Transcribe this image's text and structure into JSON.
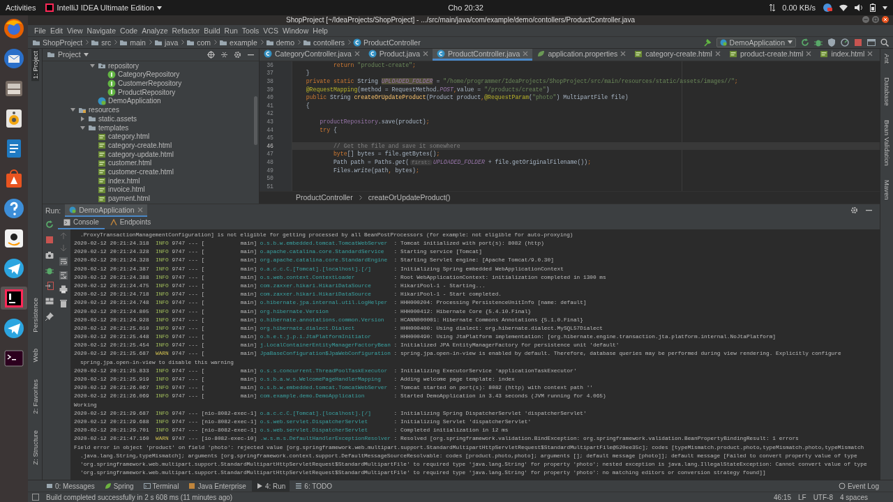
{
  "top_bar": {
    "activities": "Activities",
    "app_menu": "IntelliJ IDEA Ultimate Edition",
    "clock": "Cho 20:32",
    "net_speed": "0.00 KB/s"
  },
  "window": {
    "title": "ShopProject [~/IdeaProjects/ShopProject] - .../src/main/java/com/example/demo/contollers/ProductController.java"
  },
  "menu": [
    "File",
    "Edit",
    "View",
    "Navigate",
    "Code",
    "Analyze",
    "Refactor",
    "Build",
    "Run",
    "Tools",
    "VCS",
    "Window",
    "Help"
  ],
  "nav_bar": {
    "crumbs": [
      {
        "label": "ShopProject",
        "kind": "project"
      },
      {
        "label": "src",
        "kind": "folder"
      },
      {
        "label": "main",
        "kind": "folder"
      },
      {
        "label": "java",
        "kind": "folder"
      },
      {
        "label": "com",
        "kind": "folder"
      },
      {
        "label": "example",
        "kind": "folder"
      },
      {
        "label": "demo",
        "kind": "folder"
      },
      {
        "label": "contollers",
        "kind": "folder"
      },
      {
        "label": "ProductController",
        "kind": "class"
      }
    ],
    "run_config": "DemoApplication"
  },
  "left_strip": {
    "top": [
      {
        "label": "1: Project",
        "selected": true
      }
    ],
    "bottom": [
      {
        "label": "Persistence",
        "selected": false
      },
      {
        "label": "Web",
        "selected": false
      },
      {
        "label": "2: Favorites",
        "selected": false
      },
      {
        "label": "Z: Structure",
        "selected": false
      }
    ]
  },
  "right_strip": [
    {
      "label": "Ant"
    },
    {
      "label": "Database"
    },
    {
      "label": "Bean Validation"
    },
    {
      "label": "Maven"
    }
  ],
  "project": {
    "title": "Project",
    "tree": [
      {
        "children": [
          {
            "children": [
              {
                "name": "repository",
                "kind": "package",
                "expanded": true,
                "children": [
                  {
                    "name": "CategoryRepository",
                    "kind": "interface"
                  },
                  {
                    "name": "CustomerRepository",
                    "kind": "interface"
                  },
                  {
                    "name": "ProductRepository",
                    "kind": "interface"
                  }
                ]
              },
              {
                "name": "DemoApplication",
                "kind": "spring-class"
              }
            ]
          }
        ]
      },
      {
        "name": "resources",
        "kind": "resources",
        "expanded": true,
        "children": [
          {
            "name": "static.assets",
            "kind": "folder",
            "expanded": false
          },
          {
            "name": "templates",
            "kind": "folder",
            "expanded": true,
            "children": [
              {
                "name": "category.html",
                "kind": "html"
              },
              {
                "name": "category-create.html",
                "kind": "html"
              },
              {
                "name": "category-update.html",
                "kind": "html"
              },
              {
                "name": "customer.html",
                "kind": "html"
              },
              {
                "name": "customer-create.html",
                "kind": "html"
              },
              {
                "name": "index.html",
                "kind": "html"
              },
              {
                "name": "invoice.html",
                "kind": "html"
              },
              {
                "name": "payment.html",
                "kind": "html"
              }
            ]
          }
        ]
      }
    ]
  },
  "editor": {
    "tabs": [
      {
        "label": "CategoryController.java",
        "kind": "class",
        "selected": false
      },
      {
        "label": "Product.java",
        "kind": "class",
        "selected": false
      },
      {
        "label": "ProductController.java",
        "kind": "class",
        "selected": true
      },
      {
        "label": "application.properties",
        "kind": "properties",
        "selected": false
      },
      {
        "label": "category-create.html",
        "kind": "html",
        "selected": false
      },
      {
        "label": "product-create.html",
        "kind": "html",
        "selected": false
      },
      {
        "label": "index.html",
        "kind": "html",
        "selected": false
      }
    ],
    "lines": [
      {
        "number": "36",
        "current": false,
        "segments": [
          {
            "kind": "kw",
            "text": "            return "
          },
          {
            "kind": "str",
            "text": "\"product-create\""
          },
          {
            "kind": "kw",
            "text": ";"
          }
        ]
      },
      {
        "number": "37",
        "current": false,
        "segments": [
          {
            "kind": "plain",
            "text": "    }"
          }
        ]
      },
      {
        "number": "38",
        "current": false,
        "segments": [
          {
            "kind": "kw",
            "text": "    private static "
          },
          {
            "kind": "plain",
            "text": "String "
          },
          {
            "kind": "const-hl",
            "text": "UPLOADED_FOLDER"
          },
          {
            "kind": "plain",
            "text": " = "
          },
          {
            "kind": "str",
            "text": "\"/home/programmer/IdeaProjects/ShopProject/src/main/resources/static/assets/images//\""
          },
          {
            "kind": "kw",
            "text": ";"
          }
        ]
      },
      {
        "number": "39",
        "current": false,
        "segments": [
          {
            "kind": "ann",
            "text": "    @RequestMapping"
          },
          {
            "kind": "plain",
            "text": "(method = RequestMethod."
          },
          {
            "kind": "const",
            "text": "POST"
          },
          {
            "kind": "kw",
            "text": ","
          },
          {
            "kind": "plain",
            "text": "value = "
          },
          {
            "kind": "str",
            "text": "\"/products/create\""
          },
          {
            "kind": "plain",
            "text": ")"
          }
        ]
      },
      {
        "number": "40",
        "current": false,
        "segments": [
          {
            "kind": "kw",
            "text": "    public "
          },
          {
            "kind": "plain",
            "text": "String "
          },
          {
            "kind": "method",
            "text": "createOrUpdateProduct"
          },
          {
            "kind": "plain",
            "text": "(Product product"
          },
          {
            "kind": "kw",
            "text": ","
          },
          {
            "kind": "ann",
            "text": "@RequestParam"
          },
          {
            "kind": "plain",
            "text": "("
          },
          {
            "kind": "str",
            "text": "\"photo\""
          },
          {
            "kind": "plain",
            "text": ") MultipartFile file)"
          }
        ]
      },
      {
        "number": "41",
        "current": false,
        "segments": [
          {
            "kind": "plain",
            "text": "    {"
          }
        ]
      },
      {
        "number": "42",
        "current": false
      },
      {
        "number": "43",
        "current": false,
        "segments": [
          {
            "kind": "field",
            "text": "        productRepository"
          },
          {
            "kind": "plain",
            "text": ".save(product)"
          },
          {
            "kind": "kw",
            "text": ";"
          }
        ]
      },
      {
        "number": "44",
        "current": false,
        "segments": [
          {
            "kind": "kw",
            "text": "        try "
          },
          {
            "kind": "plain",
            "text": "{"
          }
        ]
      },
      {
        "number": "45",
        "current": false
      },
      {
        "number": "46",
        "current": true,
        "segments": [
          {
            "kind": "cmt",
            "text": "            // Get the file and save it somewhere"
          }
        ]
      },
      {
        "number": "47",
        "current": false,
        "segments": [
          {
            "kind": "kw",
            "text": "            byte"
          },
          {
            "kind": "plain",
            "text": "[] bytes = file.getBytes()"
          },
          {
            "kind": "kw",
            "text": ";"
          }
        ]
      },
      {
        "number": "48",
        "current": false,
        "segments": [
          {
            "kind": "plain",
            "text": "            Path path = Paths."
          },
          {
            "kind": "it",
            "text": "get"
          },
          {
            "kind": "plain",
            "text": "("
          },
          {
            "kind": "hint",
            "text": "first:"
          },
          {
            "kind": "const",
            "text": "UPLOADED_FOLDER"
          },
          {
            "kind": "plain",
            "text": " + file.getOriginalFilename())"
          },
          {
            "kind": "kw",
            "text": ";"
          }
        ]
      },
      {
        "number": "49",
        "current": false,
        "segments": [
          {
            "kind": "plain",
            "text": "            Files."
          },
          {
            "kind": "it",
            "text": "write"
          },
          {
            "kind": "plain",
            "text": "(path"
          },
          {
            "kind": "kw",
            "text": ","
          },
          {
            "kind": "plain",
            "text": " bytes)"
          },
          {
            "kind": "kw",
            "text": ";"
          }
        ]
      },
      {
        "number": "50",
        "current": false
      },
      {
        "number": "51",
        "current": false
      }
    ],
    "breadcrumb": [
      "ProductController",
      "createOrUpdateProduct()"
    ]
  },
  "run": {
    "label": "Run:",
    "config": "DemoApplication",
    "tabs": [
      {
        "label": "Console",
        "selected": true
      },
      {
        "label": "Endpoints",
        "selected": false
      }
    ],
    "console": [
      {
        "kind": "wrap",
        "text": ".ProxyTransactionManagementConfiguration] is not eligible for getting processed by all BeanPostProcessors (for example: not eligible for auto-proxying)"
      },
      {
        "kind": "log",
        "time": "2020-02-12 20:21:24.318",
        "level": "INFO",
        "pid_thread": "9747 --- [           main]",
        "logger": "o.s.b.w.embedded.tomcat.TomcatWebServer",
        "message": ": Tomcat initialized with port(s): 8082 (http)"
      },
      {
        "kind": "log",
        "time": "2020-02-12 20:21:24.328",
        "level": "INFO",
        "pid_thread": "9747 --- [           main]",
        "logger": "o.apache.catalina.core.StandardService",
        "message": ": Starting service [Tomcat]"
      },
      {
        "kind": "log",
        "time": "2020-02-12 20:21:24.328",
        "level": "INFO",
        "pid_thread": "9747 --- [           main]",
        "logger": "org.apache.catalina.core.StandardEngine",
        "message": ": Starting Servlet engine: [Apache Tomcat/9.0.30]"
      },
      {
        "kind": "log",
        "time": "2020-02-12 20:21:24.387",
        "level": "INFO",
        "pid_thread": "9747 --- [           main]",
        "logger": "o.a.c.c.C.[Tomcat].[localhost].[/]",
        "message": ": Initializing Spring embedded WebApplicationContext"
      },
      {
        "kind": "log",
        "time": "2020-02-12 20:21:24.388",
        "level": "INFO",
        "pid_thread": "9747 --- [           main]",
        "logger": "o.s.web.context.ContextLoader",
        "message": ": Root WebApplicationContext: initialization completed in 1300 ms"
      },
      {
        "kind": "log",
        "time": "2020-02-12 20:21:24.475",
        "level": "INFO",
        "pid_thread": "9747 --- [           main]",
        "logger": "com.zaxxer.hikari.HikariDataSource",
        "message": ": HikariPool-1 - Starting..."
      },
      {
        "kind": "log",
        "time": "2020-02-12 20:21:24.718",
        "level": "INFO",
        "pid_thread": "9747 --- [           main]",
        "logger": "com.zaxxer.hikari.HikariDataSource",
        "message": ": HikariPool-1 - Start completed."
      },
      {
        "kind": "log",
        "time": "2020-02-12 20:21:24.748",
        "level": "INFO",
        "pid_thread": "9747 --- [           main]",
        "logger": "o.hibernate.jpa.internal.util.LogHelper",
        "message": ": HHH000204: Processing PersistenceUnitInfo [name: default]"
      },
      {
        "kind": "log",
        "time": "2020-02-12 20:21:24.805",
        "level": "INFO",
        "pid_thread": "9747 --- [           main]",
        "logger": "org.hibernate.Version",
        "message": ": HHH000412: Hibernate Core {5.4.10.Final}"
      },
      {
        "kind": "log",
        "time": "2020-02-12 20:21:24.928",
        "level": "INFO",
        "pid_thread": "9747 --- [           main]",
        "logger": "o.hibernate.annotations.common.Version",
        "message": ": HCANN000001: Hibernate Commons Annotations {5.1.0.Final}"
      },
      {
        "kind": "log",
        "time": "2020-02-12 20:21:25.010",
        "level": "INFO",
        "pid_thread": "9747 --- [           main]",
        "logger": "org.hibernate.dialect.Dialect",
        "message": ": HHH000400: Using dialect: org.hibernate.dialect.MySQL57Dialect"
      },
      {
        "kind": "log",
        "time": "2020-02-12 20:21:25.448",
        "level": "INFO",
        "pid_thread": "9747 --- [           main]",
        "logger": "o.h.e.t.j.p.i.JtaPlatformInitiator",
        "message": ": HHH000490: Using JtaPlatform implementation: [org.hibernate.engine.transaction.jta.platform.internal.NoJtaPlatform]"
      },
      {
        "kind": "log",
        "time": "2020-02-12 20:21:25.454",
        "level": "INFO",
        "pid_thread": "9747 --- [           main]",
        "logger": "j.LocalContainerEntityManagerFactoryBean",
        "message": ": Initialized JPA EntityManagerFactory for persistence unit 'default'"
      },
      {
        "kind": "log",
        "time": "2020-02-12 20:21:25.687",
        "level": "WARN",
        "pid_thread": "9747 --- [           main]",
        "logger": "JpaBaseConfiguration$JpaWebConfiguration",
        "message": ": spring.jpa.open-in-view is enabled by default. Therefore, database queries may be performed during view rendering. Explicitly configure"
      },
      {
        "kind": "wrap",
        "text": "spring.jpa.open-in-view to disable this warning"
      },
      {
        "kind": "log",
        "time": "2020-02-12 20:21:25.833",
        "level": "INFO",
        "pid_thread": "9747 --- [           main]",
        "logger": "o.s.s.concurrent.ThreadPoolTaskExecutor",
        "message": ": Initializing ExecutorService 'applicationTaskExecutor'"
      },
      {
        "kind": "log",
        "time": "2020-02-12 20:21:25.919",
        "level": "INFO",
        "pid_thread": "9747 --- [           main]",
        "logger": "o.s.b.a.w.s.WelcomePageHandlerMapping",
        "message": ": Adding welcome page template: index"
      },
      {
        "kind": "log",
        "time": "2020-02-12 20:21:26.067",
        "level": "INFO",
        "pid_thread": "9747 --- [           main]",
        "logger": "o.s.b.w.embedded.tomcat.TomcatWebServer",
        "message": ": Tomcat started on port(s): 8082 (http) with context path ''"
      },
      {
        "kind": "log",
        "time": "2020-02-12 20:21:26.069",
        "level": "INFO",
        "pid_thread": "9747 --- [           main]",
        "logger": "com.example.demo.DemoApplication",
        "message": ": Started DemoApplication in 3.43 seconds (JVM running for 4.065)"
      },
      {
        "kind": "text",
        "text": "Working"
      },
      {
        "kind": "log",
        "time": "2020-02-12 20:21:29.687",
        "level": "INFO",
        "pid_thread": "9747 --- [nio-8082-exec-1]",
        "logger": "o.a.c.c.C.[Tomcat].[localhost].[/]",
        "message": ": Initializing Spring DispatcherServlet 'dispatcherServlet'"
      },
      {
        "kind": "log",
        "time": "2020-02-12 20:21:29.688",
        "level": "INFO",
        "pid_thread": "9747 --- [nio-8082-exec-1]",
        "logger": "o.s.web.servlet.DispatcherServlet",
        "message": ": Initializing Servlet 'dispatcherServlet'"
      },
      {
        "kind": "log",
        "time": "2020-02-12 20:21:29.701",
        "level": "INFO",
        "pid_thread": "9747 --- [nio-8082-exec-1]",
        "logger": "o.s.web.servlet.DispatcherServlet",
        "message": ": Completed initialization in 12 ms"
      },
      {
        "kind": "log",
        "time": "2020-02-12 20:21:47.160",
        "level": "WARN",
        "pid_thread": "9747 --- [io-8082-exec-10]",
        "logger": ".w.s.m.s.DefaultHandlerExceptionResolver",
        "message": ": Resolved [org.springframework.validation.BindException: org.springframework.validation.BeanPropertyBindingResult: 1 errors"
      },
      {
        "kind": "text",
        "text": "Field error in object 'product' on field 'photo': rejected value [org.springframework.web.multipart.support.StandardMultipartHttpServletRequest$StandardMultipartFile@520ee35c]; codes [typeMismatch.product.photo,typeMismatch.photo,typeMismatch"
      },
      {
        "kind": "wrap",
        "text": ".java.lang.String,typeMismatch]; arguments [org.springframework.context.support.DefaultMessageSourceResolvable: codes [product.photo,photo]; arguments []; default message [photo]]; default message [Failed to convert property value of type"
      },
      {
        "kind": "wrap",
        "text": "'org.springframework.web.multipart.support.StandardMultipartHttpServletRequest$StandardMultipartFile' to required type 'java.lang.String' for property 'photo'; nested exception is java.lang.IllegalStateException: Cannot convert value of type"
      },
      {
        "kind": "wrap",
        "text": "'org.springframework.web.multipart.support.StandardMultipartHttpServletRequest$StandardMultipartFile' to required type 'java.lang.String' for property 'photo': no matching editors or conversion strategy found]]"
      }
    ]
  },
  "tool_tabs": [
    {
      "label": "0: Messages",
      "kind": "messages",
      "selected": false
    },
    {
      "label": "Spring",
      "kind": "spring",
      "selected": false
    },
    {
      "label": "Terminal",
      "kind": "terminal",
      "selected": false
    },
    {
      "label": "Java Enterprise",
      "kind": "enterprise",
      "selected": false
    },
    {
      "label": "4: Run",
      "kind": "run",
      "selected": true
    },
    {
      "label": "6: TODO",
      "kind": "todo",
      "selected": false
    }
  ],
  "event_log": "Event Log",
  "status_bar": {
    "message": "Build completed successfully in 2 s 608 ms (11 minutes ago)",
    "position": "46:15",
    "line_sep": "LF",
    "encoding": "UTF-8",
    "indent": "4 spaces"
  }
}
